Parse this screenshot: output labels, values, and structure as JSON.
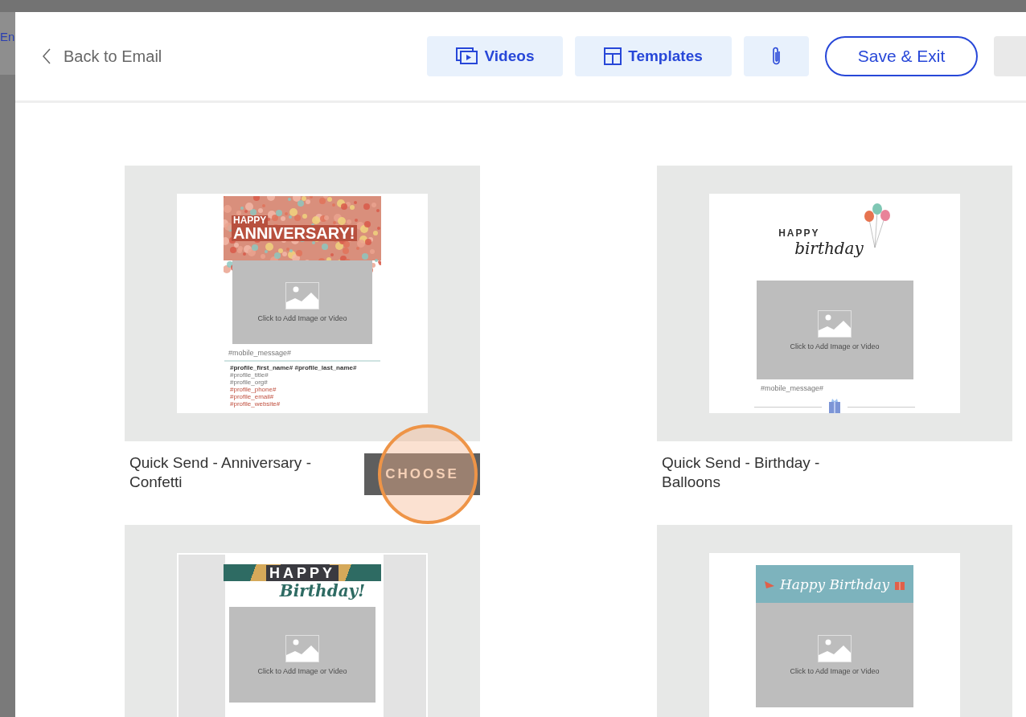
{
  "background_page": {
    "link_text": "En"
  },
  "header": {
    "back_link": "Back to Email",
    "videos_button": "Videos",
    "templates_button": "Templates",
    "save_button": "Save & Exit"
  },
  "cards": [
    {
      "title": "Quick Send - Anniversary - Confetti",
      "kind": "confetti",
      "headline": [
        "HAPPY",
        "ANNIVERSARY!"
      ],
      "caption": "Click to Add Image or Video",
      "mobile_message": "#mobile_message#",
      "profile_lines": [
        {
          "text": "#profile_first_name# #profile_last_name#",
          "kind": "name"
        },
        {
          "text": "#profile_title#",
          "kind": "plain"
        },
        {
          "text": "#profile_org#",
          "kind": "plain"
        },
        {
          "text": "#profile_phone#",
          "kind": "link"
        },
        {
          "text": "#profile_email#",
          "kind": "link"
        },
        {
          "text": "#profile_website#",
          "kind": "link"
        }
      ],
      "choose_button": "CHOOSE",
      "highlighted": true
    },
    {
      "title": "Quick Send - Birthday - Balloons",
      "kind": "balloons",
      "headline": [
        "HAPPY",
        "birthday"
      ],
      "caption": "Click to Add Image or Video",
      "mobile_message": "#mobile_message#"
    },
    {
      "kind": "geometric",
      "headline": [
        "HAPPY",
        "Birthday!"
      ],
      "caption": "Click to Add Image or Video"
    },
    {
      "kind": "banner",
      "headline": [
        "Happy Birthday"
      ],
      "caption": "Click to Add Image or Video"
    }
  ]
}
